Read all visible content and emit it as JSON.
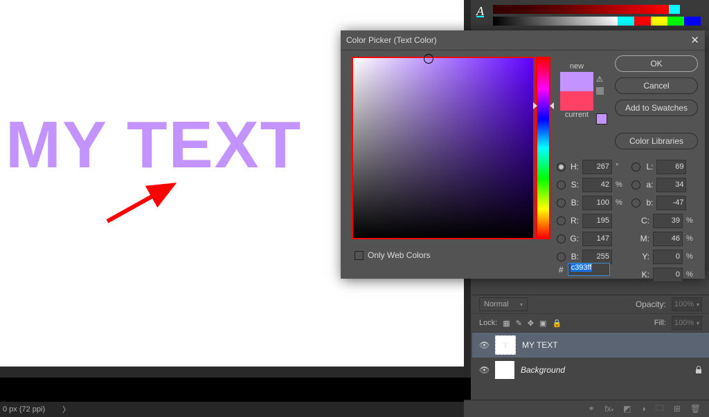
{
  "status_bar": "0 px (72 ppi)",
  "dialog": {
    "title": "Color Picker (Text Color)",
    "ok": "OK",
    "cancel": "Cancel",
    "add_swatches": "Add to Swatches",
    "color_libs": "Color Libraries",
    "only_web": "Only Web Colors",
    "new_label": "new",
    "current_label": "current",
    "hex_label": "#",
    "hex_value": "c393ff",
    "hsv": {
      "H": "267",
      "S": "42",
      "B": "100"
    },
    "lab": {
      "L": "69",
      "a": "34",
      "b": "-47"
    },
    "rgb": {
      "R": "195",
      "G": "147",
      "B": "255"
    },
    "cmyk": {
      "C": "39",
      "M": "46",
      "Y": "0",
      "K": "0"
    },
    "deg": "°",
    "pct": "%"
  },
  "canvas": {
    "text": "MY TEXT"
  },
  "layers": {
    "blend": "Normal",
    "opacity_label": "Opacity:",
    "opacity_val": "100%",
    "lock_label": "Lock:",
    "fill_label": "Fill:",
    "fill_val": "100%",
    "items": [
      {
        "name": "MY TEXT",
        "type": "T"
      },
      {
        "name": "Background",
        "type": "fill"
      }
    ]
  }
}
